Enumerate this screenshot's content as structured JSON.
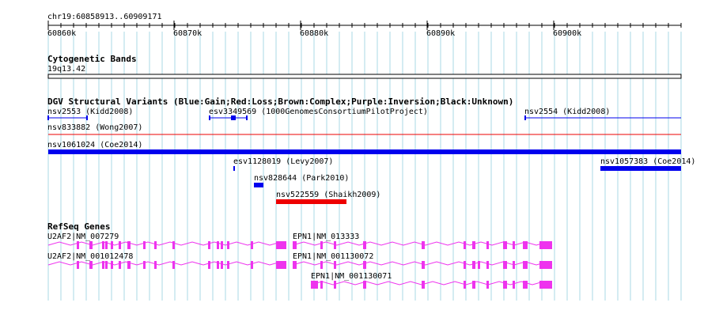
{
  "location": "chr19:60858913..60909171",
  "ruler": {
    "ticks": [
      "60860k",
      "60870k",
      "60880k",
      "60890k",
      "60900k"
    ]
  },
  "colors": {
    "grid": "#a9d8e6",
    "track_line": "#000000",
    "dgv_blue": "#0000ee",
    "dgv_red": "#ee0000",
    "gene": "#ee33ee"
  },
  "tracks": {
    "cyto": {
      "title": "Cytogenetic Bands",
      "band": "19q13.42"
    },
    "dgv": {
      "title": "DGV Structural Variants (Blue:Gain;Red:Loss;Brown:Complex;Purple:Inversion;Black:Unknown)",
      "features": [
        {
          "label": "nsv2553 (Kidd2008)",
          "color": "blue",
          "style": "line"
        },
        {
          "label": "esv3349569 (1000GenomesConsortiumPilotProject)",
          "color": "blue",
          "style": "line"
        },
        {
          "label": "nsv2554 (Kidd2008)",
          "color": "blue",
          "style": "line"
        },
        {
          "label": "nsv833882 (Wong2007)",
          "color": "red",
          "style": "line"
        },
        {
          "label": "nsv1061024 (Coe2014)",
          "color": "blue",
          "style": "bar"
        },
        {
          "label": "esv1128019 (Levy2007)",
          "color": "blue",
          "style": "tick"
        },
        {
          "label": "nsv1057383 (Coe2014)",
          "color": "blue",
          "style": "bar"
        },
        {
          "label": "nsv828644 (Park2010)",
          "color": "blue",
          "style": "bar"
        },
        {
          "label": "nsv522559 (Shaikh2009)",
          "color": "red",
          "style": "bar"
        }
      ]
    },
    "refseq": {
      "title": "RefSeq Genes",
      "genes": [
        {
          "label": "U2AF2|NM_007279"
        },
        {
          "label": "EPN1|NM_013333"
        },
        {
          "label": "U2AF2|NM_001012478"
        },
        {
          "label": "EPN1|NM_001130072"
        },
        {
          "label": "EPN1|NM_001130071"
        }
      ]
    }
  }
}
